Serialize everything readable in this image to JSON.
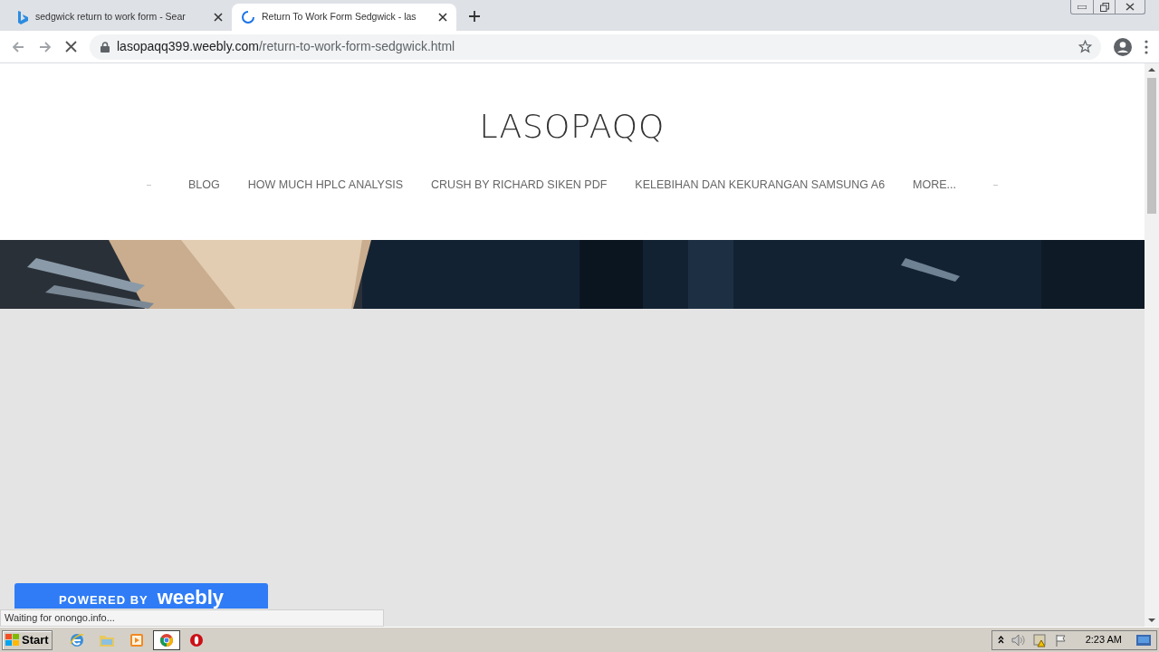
{
  "tabs": [
    {
      "title": "sedgwick return to work form - Sear",
      "selected": false,
      "loading": false
    },
    {
      "title": "Return To Work Form Sedgwick - las",
      "selected": true,
      "loading": true
    }
  ],
  "address": {
    "domain": "lasopaqq399.weebly.com",
    "path": "/return-to-work-form-sedgwick.html"
  },
  "site": {
    "title": "LASOPAQQ",
    "nav_left_mark": "–",
    "nav": [
      "BLOG",
      "HOW MUCH HPLC ANALYSIS",
      "CRUSH BY RICHARD SIKEN PDF",
      "KELEBIHAN DAN KEKURANGAN SAMSUNG A6",
      "MORE..."
    ],
    "nav_right_mark": "–"
  },
  "badge": {
    "prefix": "POWERED BY",
    "brand": "weebly"
  },
  "status_text": "Waiting for onongo.info...",
  "taskbar": {
    "start": "Start",
    "apps": [
      {
        "kind": "ie",
        "selected": false
      },
      {
        "kind": "folder",
        "selected": false
      },
      {
        "kind": "media",
        "selected": false
      },
      {
        "kind": "chrome",
        "selected": true
      },
      {
        "kind": "opera",
        "selected": false
      }
    ],
    "time": "2:23 AM"
  }
}
